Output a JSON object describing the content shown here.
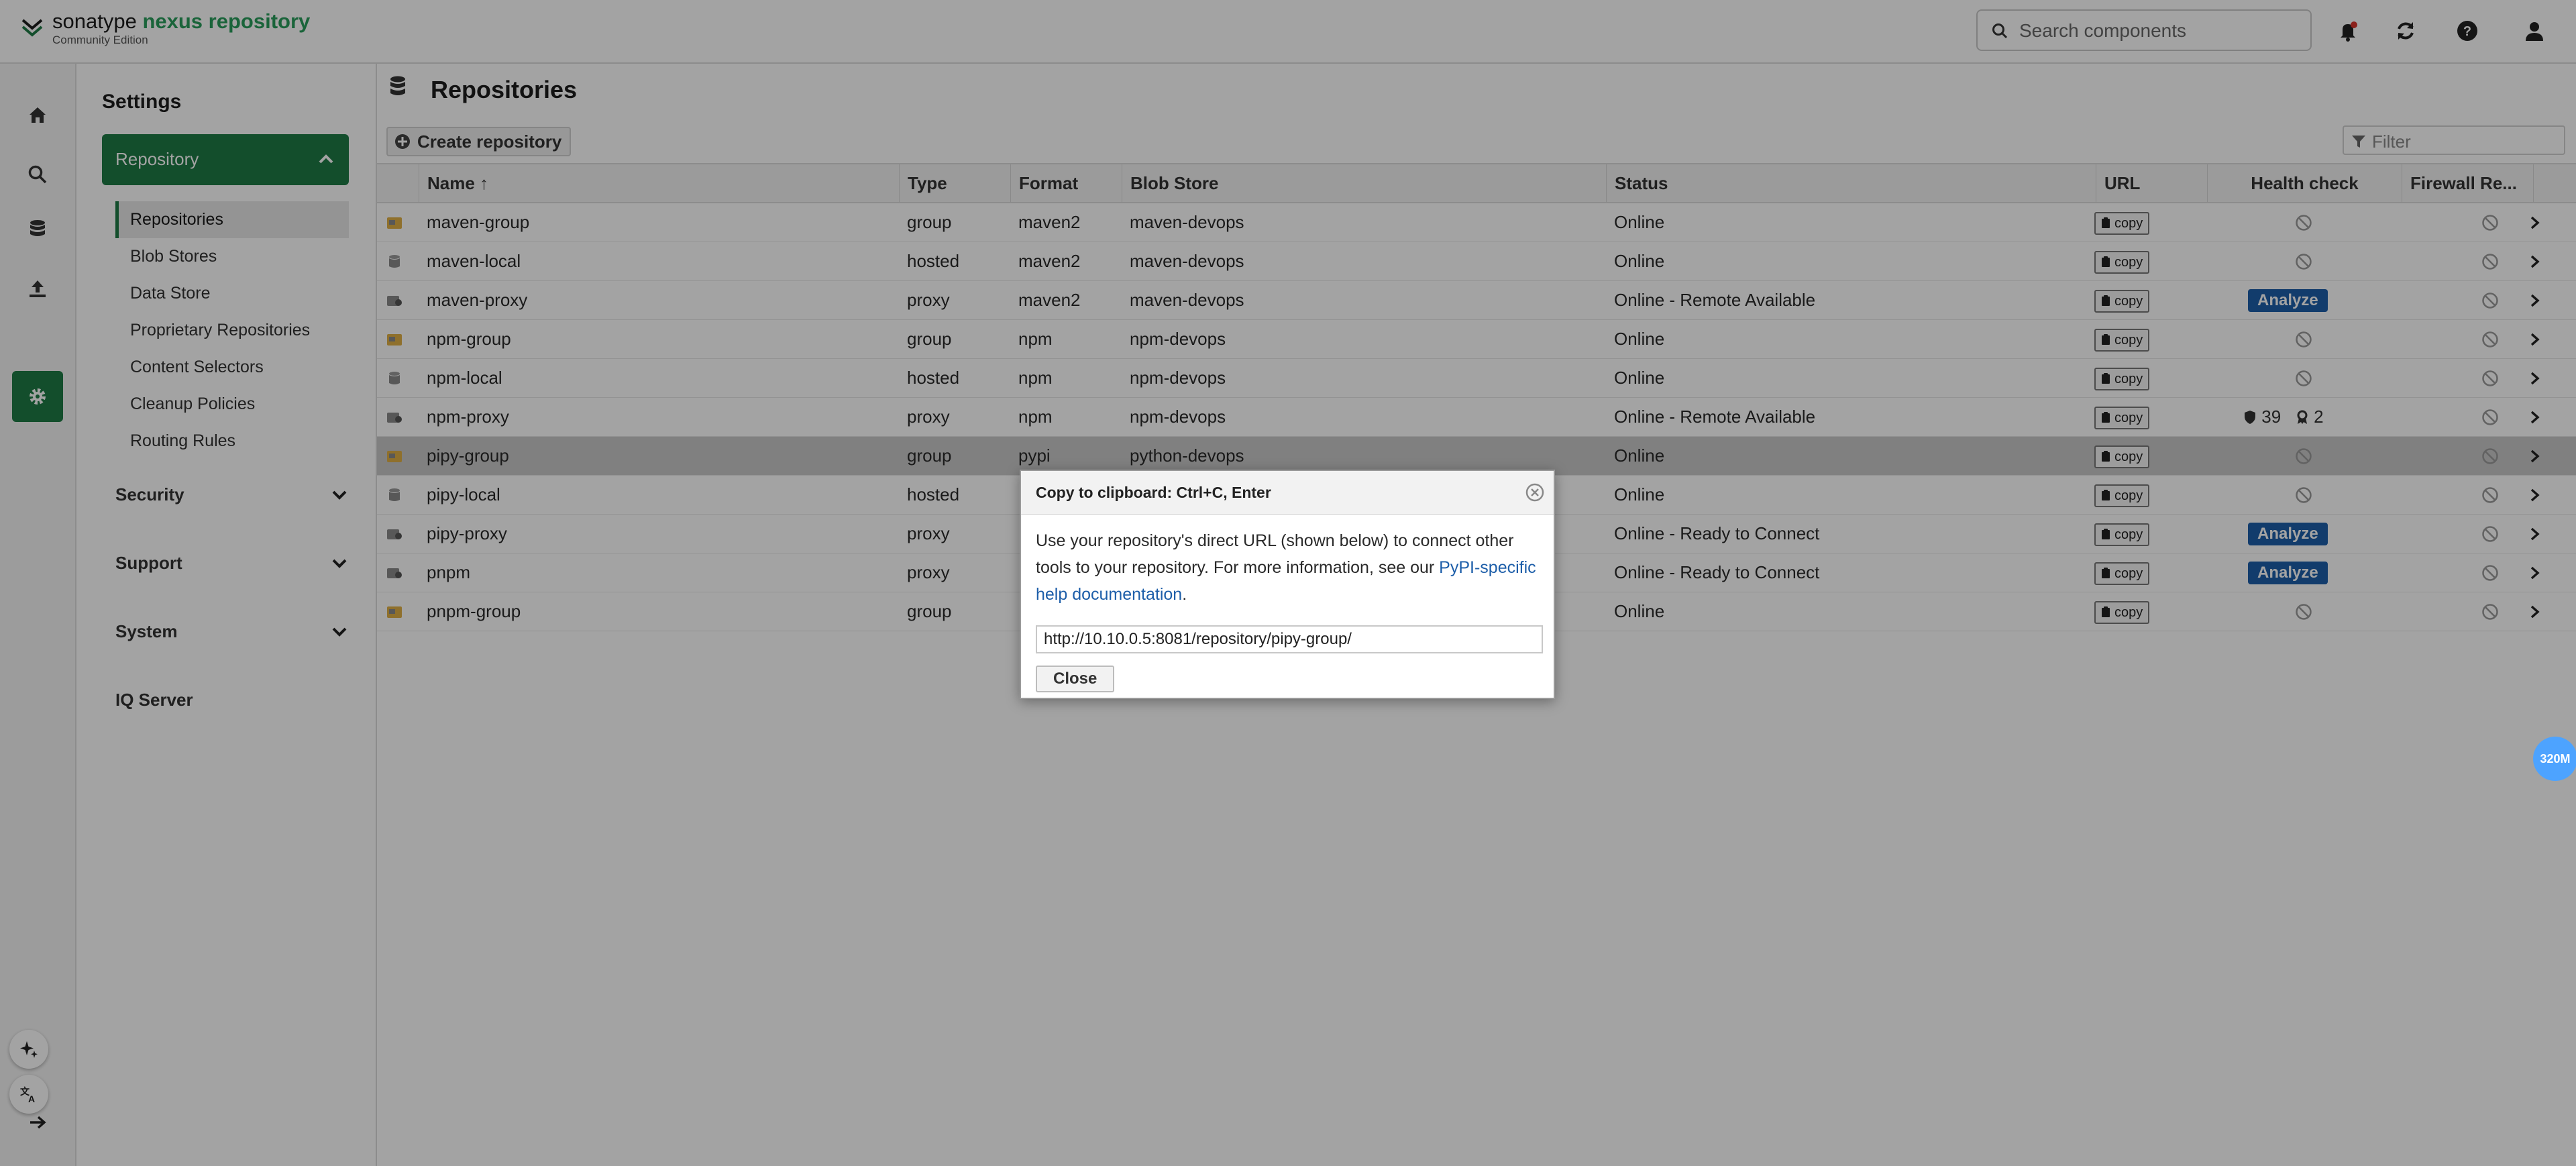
{
  "header": {
    "brand": "sonatype",
    "product": "nexus repository",
    "edition": "Community Edition",
    "search_placeholder": "Search components"
  },
  "settings": {
    "title": "Settings",
    "active_section": "Repository",
    "subnav": [
      "Repositories",
      "Blob Stores",
      "Data Store",
      "Proprietary Repositories",
      "Content Selectors",
      "Cleanup Policies",
      "Routing Rules"
    ],
    "groups": [
      "Security",
      "Support",
      "System"
    ],
    "iq_server": "IQ Server"
  },
  "main": {
    "title": "Repositories",
    "create_label": "Create repository",
    "filter_placeholder": "Filter"
  },
  "table": {
    "columns": {
      "name": "Name ↑",
      "type": "Type",
      "format": "Format",
      "blob_store": "Blob Store",
      "status": "Status",
      "url": "URL",
      "health": "Health check",
      "firewall": "Firewall Re..."
    },
    "copy_label": "copy",
    "analyze_label": "Analyze",
    "rows": [
      {
        "name": "maven-group",
        "type": "group",
        "format": "maven2",
        "blob": "maven-devops",
        "status": "Online",
        "health": "none",
        "icon": "group"
      },
      {
        "name": "maven-local",
        "type": "hosted",
        "format": "maven2",
        "blob": "maven-devops",
        "status": "Online",
        "health": "none",
        "icon": "hosted"
      },
      {
        "name": "maven-proxy",
        "type": "proxy",
        "format": "maven2",
        "blob": "maven-devops",
        "status": "Online - Remote Available",
        "health": "analyze",
        "icon": "proxy"
      },
      {
        "name": "npm-group",
        "type": "group",
        "format": "npm",
        "blob": "npm-devops",
        "status": "Online",
        "health": "none",
        "icon": "group"
      },
      {
        "name": "npm-local",
        "type": "hosted",
        "format": "npm",
        "blob": "npm-devops",
        "status": "Online",
        "health": "none",
        "icon": "hosted"
      },
      {
        "name": "npm-proxy",
        "type": "proxy",
        "format": "npm",
        "blob": "npm-devops",
        "status": "Online - Remote Available",
        "health": "counts",
        "security_count": "39",
        "license_count": "2",
        "icon": "proxy"
      },
      {
        "name": "pipy-group",
        "type": "group",
        "format": "pypi",
        "blob": "python-devops",
        "status": "Online",
        "health": "none",
        "icon": "group",
        "selected": true
      },
      {
        "name": "pipy-local",
        "type": "hosted",
        "format": "",
        "blob": "",
        "status": "Online",
        "health": "none",
        "icon": "hosted"
      },
      {
        "name": "pipy-proxy",
        "type": "proxy",
        "format": "",
        "blob": "",
        "status": "Online - Ready to Connect",
        "health": "analyze",
        "icon": "proxy"
      },
      {
        "name": "pnpm",
        "type": "proxy",
        "format": "",
        "blob": "",
        "status": "Online - Ready to Connect",
        "health": "analyze",
        "icon": "proxy"
      },
      {
        "name": "pnpm-group",
        "type": "group",
        "format": "",
        "blob": "",
        "status": "Online",
        "health": "none",
        "icon": "group"
      }
    ]
  },
  "dialog": {
    "title": "Copy to clipboard: Ctrl+C, Enter",
    "body_text": "Use your repository's direct URL (shown below) to connect other tools to your repository. For more information, see our ",
    "link_text": "PyPI-specific help documentation",
    "body_end": ".",
    "url_value": "http://10.10.0.5:8081/repository/pipy-group/",
    "close_label": "Close"
  },
  "memory_badge": "320M",
  "colors": {
    "brand_green": "#1f7b45",
    "analyze_blue": "#1d5ea9",
    "link_blue": "#1d5ea9"
  }
}
